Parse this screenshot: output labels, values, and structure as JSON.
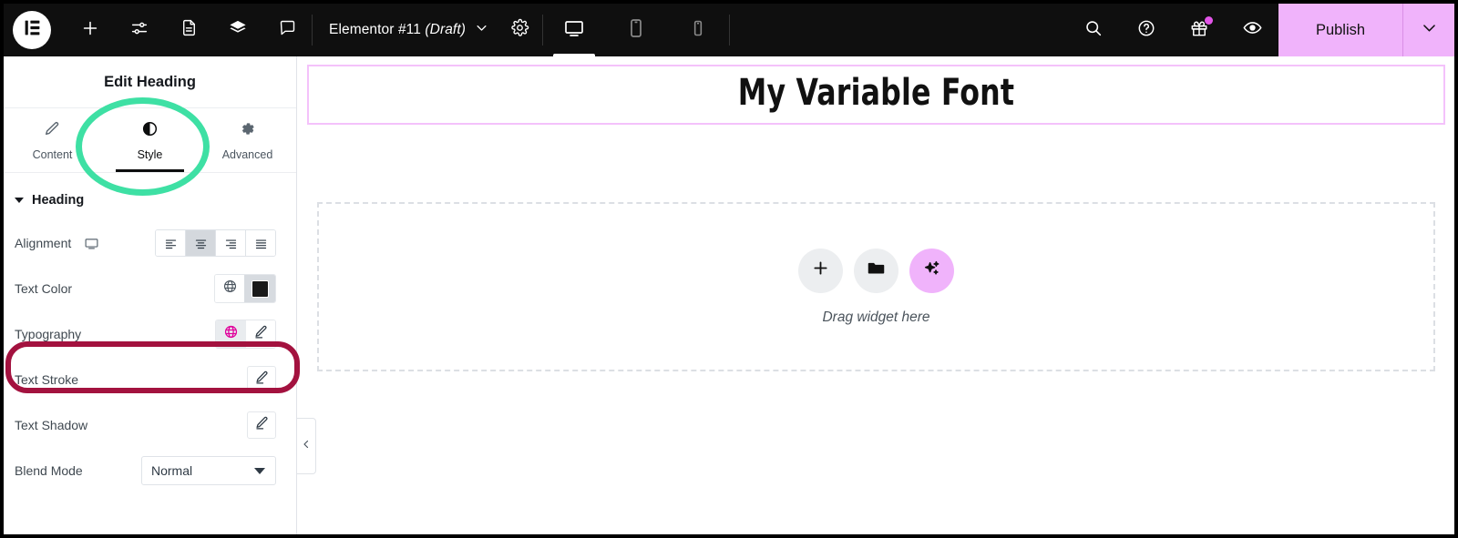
{
  "topbar": {
    "logo_icon": "elementor-logo-icon",
    "left_icons": [
      {
        "name": "add-element-icon",
        "label": "Add Element"
      },
      {
        "name": "site-settings-sliders-icon",
        "label": "Site Settings"
      },
      {
        "name": "page-document-icon",
        "label": "Page Settings"
      },
      {
        "name": "layers-structure-icon",
        "label": "Structure"
      },
      {
        "name": "comment-bubble-icon",
        "label": "Notes"
      }
    ],
    "document_title": "Elementor #11",
    "document_status": "(Draft)",
    "title_chevron_icon": "chevron-down-icon",
    "settings_icon": "gear-icon",
    "devices": [
      {
        "name": "desktop-preview-icon",
        "label": "Desktop",
        "active": true
      },
      {
        "name": "tablet-preview-icon",
        "label": "Tablet",
        "active": false
      },
      {
        "name": "mobile-preview-icon",
        "label": "Mobile",
        "active": false
      }
    ],
    "right_icons": [
      {
        "name": "search-icon",
        "label": "Finder"
      },
      {
        "name": "help-question-icon",
        "label": "Help"
      },
      {
        "name": "gift-icon",
        "label": "What's New",
        "badge": true
      },
      {
        "name": "eye-preview-icon",
        "label": "Preview Changes"
      }
    ],
    "publish_label": "Publish",
    "publish_arrow_icon": "chevron-down-icon",
    "publish_color": "#f0b3fb"
  },
  "sidebar": {
    "panel_title": "Edit Heading",
    "tabs": [
      {
        "label": "Content",
        "icon": "pencil-icon",
        "active": false
      },
      {
        "label": "Style",
        "icon": "contrast-half-circle-icon",
        "active": true
      },
      {
        "label": "Advanced",
        "icon": "gear-icon",
        "active": false
      }
    ],
    "section": {
      "label": "Heading",
      "caret_icon": "caret-down-icon",
      "expanded": true
    },
    "controls": {
      "alignment": {
        "label": "Alignment",
        "responsive_icon": "desktop-icon",
        "options": [
          {
            "name": "align-left",
            "icon": "align-left-icon",
            "active": false
          },
          {
            "name": "align-center",
            "icon": "align-center-icon",
            "active": true
          },
          {
            "name": "align-right",
            "icon": "align-right-icon",
            "active": false
          },
          {
            "name": "align-justify",
            "icon": "align-justify-icon",
            "active": false
          }
        ]
      },
      "text_color": {
        "label": "Text Color",
        "globe_icon": "globe-icon",
        "swatch_color": "#1a1a1a"
      },
      "typography": {
        "label": "Typography",
        "globe_icon": "globe-icon",
        "globe_color": "#e0009b",
        "edit_icon": "pencil-icon"
      },
      "text_stroke": {
        "label": "Text Stroke",
        "edit_icon": "pencil-icon"
      },
      "text_shadow": {
        "label": "Text Shadow",
        "edit_icon": "pencil-icon"
      },
      "blend_mode": {
        "label": "Blend Mode",
        "value": "Normal",
        "caret_icon": "caret-down-icon"
      }
    },
    "collapse_icon": "chevron-left-icon"
  },
  "canvas": {
    "heading_text": "My Variable Font",
    "selection_border_color": "#f4c2fb",
    "dropzone": {
      "buttons": [
        {
          "name": "add-widget-button",
          "icon": "plus-icon",
          "color": "#eceef0"
        },
        {
          "name": "open-template-library-button",
          "icon": "folder-icon",
          "color": "#eceef0"
        },
        {
          "name": "ai-generate-button",
          "icon": "sparkles-ai-icon",
          "color": "#f0b3fb"
        }
      ],
      "label": "Drag widget here"
    }
  },
  "annotations": [
    {
      "name": "style-tab-highlight",
      "shape": "ellipse",
      "color": "#3ee0a4"
    },
    {
      "name": "typography-row-highlight",
      "shape": "ellipse",
      "color": "#a3123f"
    }
  ]
}
